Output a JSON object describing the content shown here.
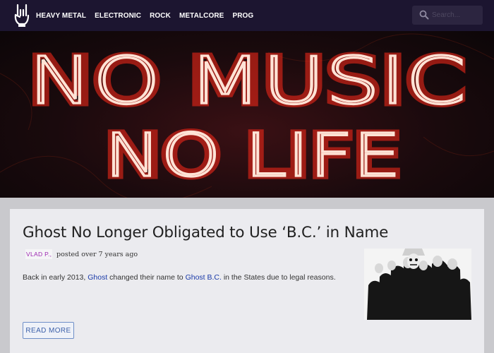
{
  "navbar": {
    "logo_icon": "rock-hand-icon",
    "items": [
      {
        "label": "HEAVY METAL"
      },
      {
        "label": "ELECTRONIC"
      },
      {
        "label": "ROCK"
      },
      {
        "label": "METALCORE"
      },
      {
        "label": "PROG"
      }
    ],
    "search": {
      "placeholder": "Search...",
      "value": "",
      "icon": "search-icon"
    },
    "background": "#1c1530"
  },
  "hero": {
    "line1": "NO MUSIC",
    "line2": "NO LIFE",
    "neon_color": "#ff2a1a"
  },
  "post": {
    "title": "Ghost No Longer Obligated to Use ‘B.C.’ in Name",
    "author": "VLAD P.,",
    "posted": "posted over 7 years ago",
    "excerpt_before": "Back in early 2013, ",
    "link1": "Ghost",
    "excerpt_middle": " changed their name to ",
    "link2": "Ghost B.C.",
    "excerpt_after": " in the States due to legal reasons.",
    "read_more": "READ MORE"
  }
}
